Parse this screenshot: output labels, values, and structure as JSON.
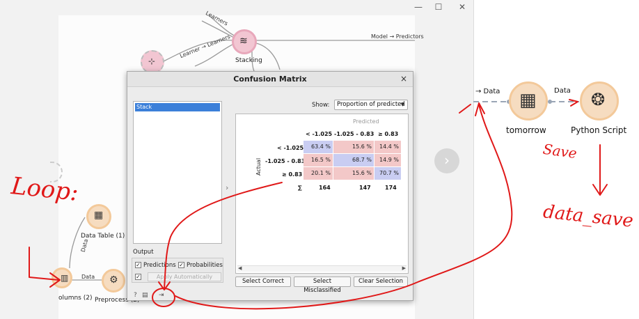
{
  "window": {
    "minimize_glyph": "—",
    "maximize_glyph": "☐",
    "close_glyph": "✕"
  },
  "canvas": {
    "nodes": {
      "stacking": "Stacking",
      "data_table": "Data Table (1)",
      "columns": "olumns (2)",
      "preprocess": "Preprocess (2)"
    },
    "links": {
      "model_predictors": "Model → Predictors",
      "learner_learners": "Learner → Learners",
      "learners": "Learners",
      "data_vertical": "Data",
      "data_horizontal": "Data"
    },
    "next_glyph": "›",
    "colors": {
      "stacking_node": "#f2c6d2",
      "tree_node": "#f2c6d2",
      "data_node": "#f6dcc0",
      "preprocess_node": "#f6dcc0"
    }
  },
  "dialog": {
    "title": "Confusion Matrix",
    "close_glyph": "×",
    "learners_list": [
      "Stack"
    ],
    "output_label": "Output",
    "predictions_label": "Predictions",
    "probabilities_label": "Probabilities",
    "apply_label": "Apply Automatically",
    "collapse_glyph": "›",
    "show_label": "Show:",
    "show_value": "Proportion of predicted",
    "predicted_label": "Predicted",
    "actual_label": "Actual",
    "col_headers": [
      "< -1.025",
      "-1.025 - 0.83",
      "≥ 0.83"
    ],
    "rows": [
      {
        "label": "< -1.025",
        "cells": [
          "63.4 %",
          "15.6 %",
          "14.4 %"
        ]
      },
      {
        "label": "-1.025 - 0.83",
        "cells": [
          "16.5 %",
          "68.7 %",
          "14.9 %"
        ]
      },
      {
        "label": "≥ 0.83",
        "cells": [
          "20.1 %",
          "15.6 %",
          "70.7 %"
        ]
      }
    ],
    "sum_label": "∑",
    "col_sums": [
      "164",
      "147",
      "174"
    ],
    "buttons": {
      "select_correct": "Select Correct",
      "select_misclassified": "Select Misclassified",
      "clear_selection": "Clear Selection"
    },
    "status_icons": [
      "?",
      "▤",
      "⇥"
    ],
    "colors": {
      "diagonal": "#c9cdf2",
      "off_diagonal": "#f3c8c8",
      "selected": "#3b7fd9"
    }
  },
  "workflow": {
    "data_in": "→ Data",
    "tomorrow": "tomorrow",
    "data_link": "Data",
    "python_script": "Python Script"
  },
  "annotations": {
    "loop": "Loop:",
    "save": "Save",
    "data_save": "data_save"
  }
}
